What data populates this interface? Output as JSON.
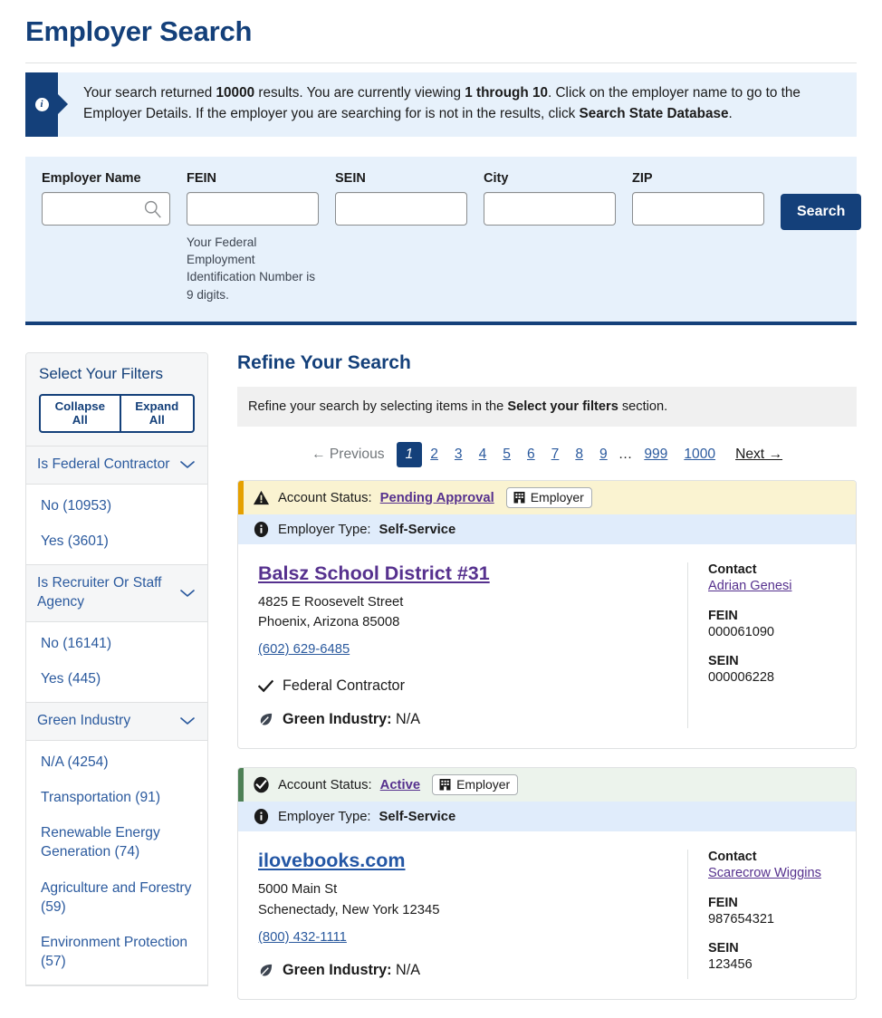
{
  "page": {
    "title": "Employer Search"
  },
  "alert": {
    "icon": "info-icon",
    "text_1": "Your search returned ",
    "count": "10000",
    "text_2": " results. You are currently viewing ",
    "range": "1 through 10",
    "text_3": ". Click on the employer name to go to the Employer Details. If the employer you are searching for is not in the results, click ",
    "cta": "Search State Database",
    "text_4": "."
  },
  "search_form": {
    "fields": [
      {
        "label": "Employer Name",
        "value": "",
        "placeholder": "",
        "icon": "search-icon",
        "hint": ""
      },
      {
        "label": "FEIN",
        "value": "",
        "placeholder": "",
        "hint": "Your Federal Employment Identification Number is 9 digits."
      },
      {
        "label": "SEIN",
        "value": "",
        "placeholder": "",
        "hint": ""
      },
      {
        "label": "City",
        "value": "",
        "placeholder": "",
        "hint": ""
      },
      {
        "label": "ZIP",
        "value": "",
        "placeholder": "",
        "hint": ""
      }
    ],
    "submit_label": "Search"
  },
  "sidebar": {
    "title": "Select Your Filters",
    "collapse_all": "Collapse All",
    "expand_all": "Expand All",
    "groups": [
      {
        "label": "Is Federal Contractor",
        "options": [
          "No (10953)",
          "Yes (3601)"
        ]
      },
      {
        "label": "Is Recruiter Or Staff Agency",
        "options": [
          "No (16141)",
          "Yes (445)"
        ]
      },
      {
        "label": "Green Industry",
        "options": [
          "N/A (4254)",
          "Transportation (91)",
          "Renewable Energy Generation (74)",
          "Agriculture and Forestry (59)",
          "Environment Protection (57)"
        ]
      }
    ]
  },
  "main": {
    "refine_title": "Refine Your Search",
    "refine_note_1": "Refine your search by selecting items in the ",
    "refine_note_bold": "Select your filters",
    "refine_note_2": " section."
  },
  "pagination": {
    "previous": "← Previous",
    "pages": [
      "1",
      "2",
      "3",
      "4",
      "5",
      "6",
      "7",
      "8",
      "9"
    ],
    "ellipsis": "…",
    "tail_pages": [
      "999",
      "1000"
    ],
    "next": "Next →",
    "current": "1"
  },
  "results": [
    {
      "status_icon": "warning-icon",
      "status_label": "Account Status:",
      "status_value": "Pending Approval",
      "status_kind": "warn",
      "badge_icon": "building-icon",
      "badge_label": "Employer",
      "type_icon": "info-icon",
      "type_label": "Employer Type:",
      "type_value": "Self-Service",
      "name": "Balsz School District #31",
      "name_state": "visited",
      "address_line1": "4825 E Roosevelt Street",
      "address_line2": "Phoenix, Arizona 85008",
      "phone": "(602) 629-6485",
      "federal_contractor_icon": "check-icon",
      "federal_contractor": "Federal Contractor",
      "green_icon": "leaf-icon",
      "green_label": "Green Industry:",
      "green_value": "N/A",
      "contact_label": "Contact",
      "contact_name": "Adrian Genesi",
      "fein_label": "FEIN",
      "fein_value": "000061090",
      "sein_label": "SEIN",
      "sein_value": "000006228"
    },
    {
      "status_icon": "check-circle-icon",
      "status_label": "Account Status:",
      "status_value": "Active",
      "status_kind": "ok",
      "badge_icon": "building-icon",
      "badge_label": "Employer",
      "type_icon": "info-icon",
      "type_label": "Employer Type:",
      "type_value": "Self-Service",
      "name": "ilovebooks.com",
      "name_state": "unvisited",
      "address_line1": "5000 Main St",
      "address_line2": "Schenectady, New York 12345",
      "phone": "(800) 432-1111",
      "federal_contractor_icon": "",
      "federal_contractor": "",
      "green_icon": "leaf-icon",
      "green_label": "Green Industry:",
      "green_value": "N/A",
      "contact_label": "Contact",
      "contact_name": "Scarecrow Wiggins",
      "fein_label": "FEIN",
      "fein_value": "987654321",
      "sein_label": "SEIN",
      "sein_value": "123456"
    }
  ],
  "colors": {
    "brand_navy": "#14407a",
    "link_blue": "#2b5a9e",
    "visited_purple": "#56318e",
    "alert_bg": "#e7f1fb",
    "warn_bg": "#faf3d1",
    "warn_border": "#e5a000",
    "ok_bg": "#ecf3ec",
    "ok_border": "#4d8055"
  }
}
